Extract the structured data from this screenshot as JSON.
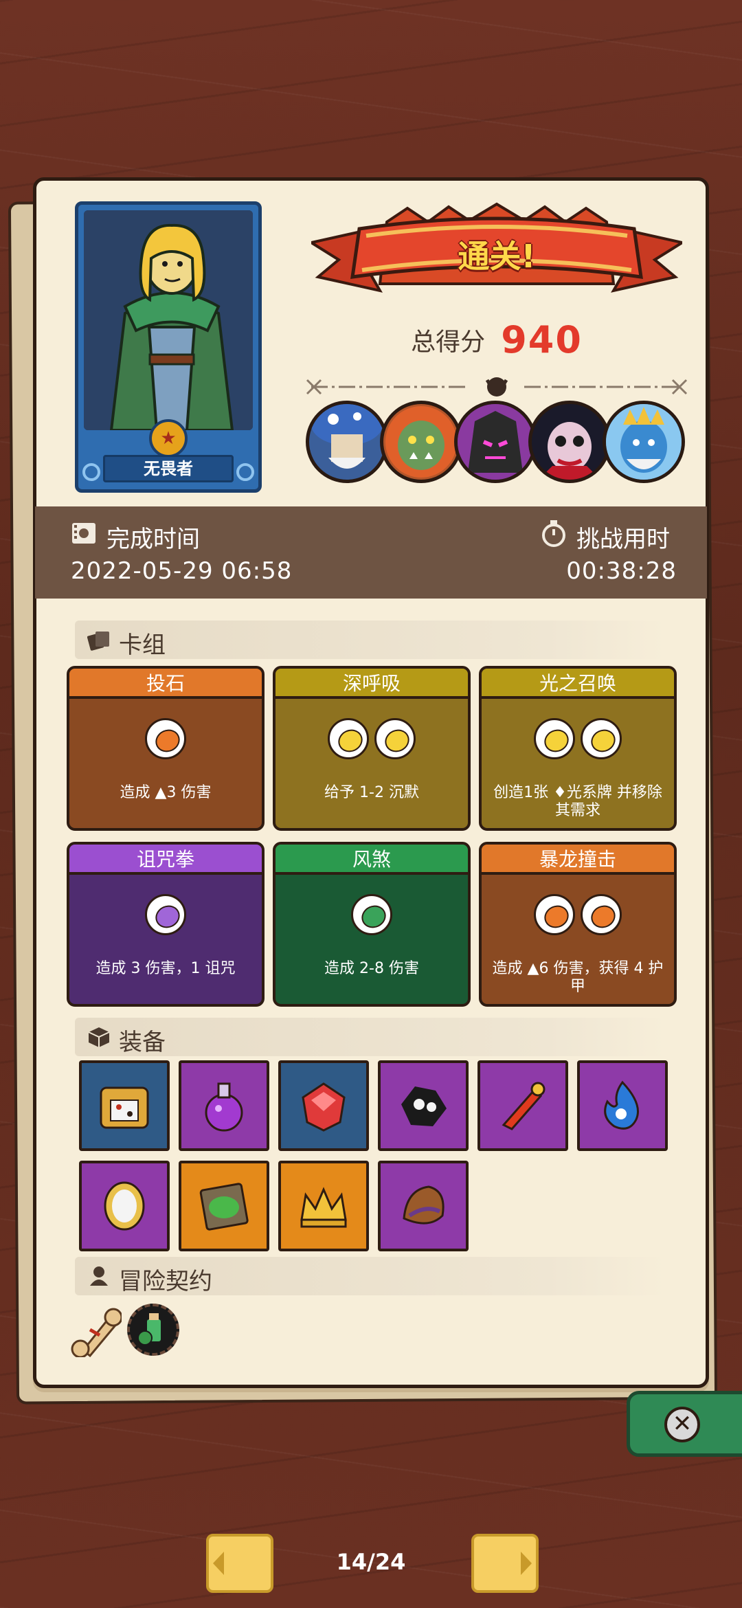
{
  "hero": {
    "name": "无畏者"
  },
  "banner": {
    "title": "通关!"
  },
  "score": {
    "label": "总得分",
    "value": "940"
  },
  "bosses": [
    "mushroom-boss",
    "orc-boss",
    "dark-knight-boss",
    "vampire-boss",
    "ice-king-boss"
  ],
  "time": {
    "complete_label": "完成时间",
    "complete_value": "2022-05-29 06:58",
    "challenge_label": "挑战用时",
    "challenge_value": "00:38:28"
  },
  "deck": {
    "title": "卡组",
    "cards": [
      {
        "name": "投石",
        "desc": "造成 ▲3 伤害",
        "orbs": 1,
        "color": "#8a4a22",
        "head": "#e1782a",
        "orb": "#ec7a2a"
      },
      {
        "name": "深呼吸",
        "desc": "给予 1-2 沉默",
        "orbs": 2,
        "color": "#8e7220",
        "head": "#b59a16",
        "orb": "#f5d23a"
      },
      {
        "name": "光之召唤",
        "desc": "创造1张 ♦光系牌 并移除其需求",
        "orbs": 2,
        "color": "#8e7220",
        "head": "#b59a16",
        "orb": "#f5d23a"
      },
      {
        "name": "诅咒拳",
        "desc": "造成 3 伤害，1 诅咒",
        "orbs": 1,
        "color": "#4f2c70",
        "head": "#9b4fd0",
        "orb": "#a066d8"
      },
      {
        "name": "风煞",
        "desc": "造成 2-8 伤害",
        "orbs": 1,
        "color": "#1a5a34",
        "head": "#2b9a4e",
        "orb": "#3aa35a"
      },
      {
        "name": "暴龙撞击",
        "desc": "造成 ▲6 伤害，获得 4 护甲",
        "orbs": 2,
        "color": "#8a4a22",
        "head": "#e1782a",
        "orb": "#ec7a2a"
      }
    ]
  },
  "equipment": {
    "title": "装备",
    "items": [
      {
        "name": "dice-box-icon",
        "bg": "#2f5a86"
      },
      {
        "name": "potion-icon",
        "bg": "#8e3aa8"
      },
      {
        "name": "ruby-icon",
        "bg": "#2f5a86"
      },
      {
        "name": "skull-rune-icon",
        "bg": "#8e3aa8"
      },
      {
        "name": "dagger-icon",
        "bg": "#8e3aa8"
      },
      {
        "name": "blue-flame-icon",
        "bg": "#8e3aa8"
      },
      {
        "name": "mirror-icon",
        "bg": "#8e3aa8"
      },
      {
        "name": "moss-book-icon",
        "bg": "#e48a1a"
      },
      {
        "name": "crown-icon",
        "bg": "#e48a1a"
      },
      {
        "name": "leather-bag-icon",
        "bg": "#8e3aa8"
      }
    ]
  },
  "contract": {
    "title": "冒险契约"
  },
  "nav": {
    "page": "14/24"
  },
  "colors": {
    "paper": "#f7eed9",
    "panel": "#6e5443",
    "score": "#e33a2b"
  }
}
